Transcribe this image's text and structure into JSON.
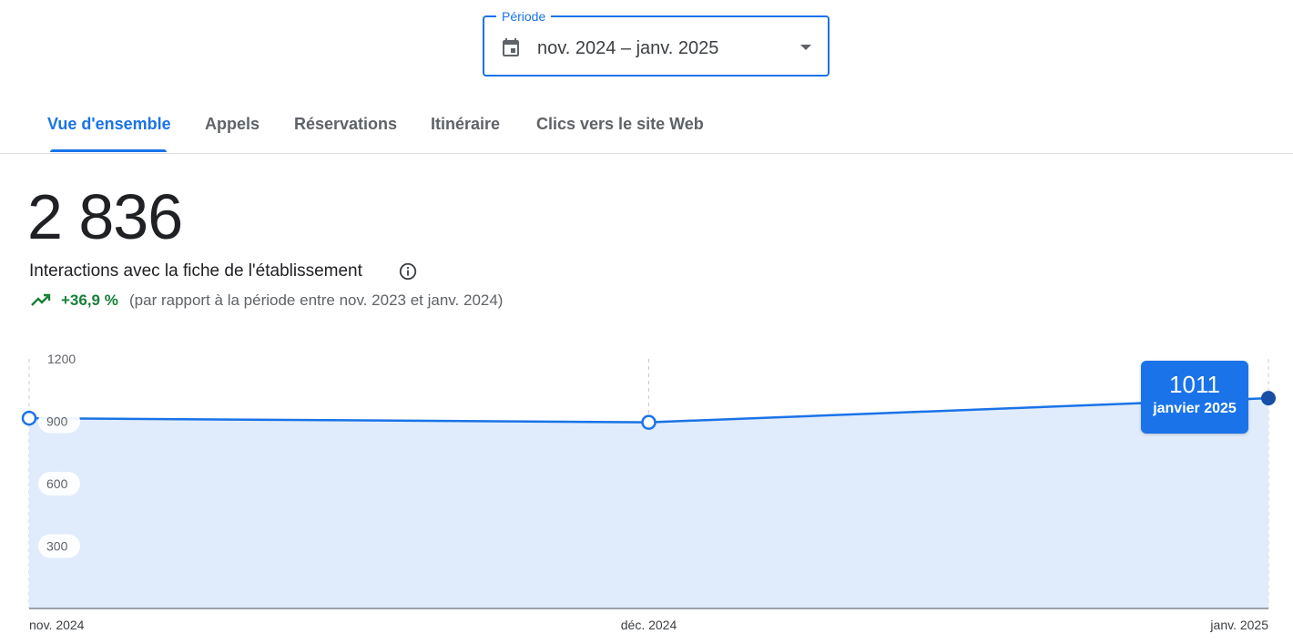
{
  "period": {
    "label": "Période",
    "value": "nov. 2024 – janv. 2025",
    "icon": "calendar-icon"
  },
  "tabs": [
    {
      "label": "Vue d'ensemble",
      "active": true
    },
    {
      "label": "Appels",
      "active": false
    },
    {
      "label": "Réservations",
      "active": false
    },
    {
      "label": "Itinéraire",
      "active": false
    },
    {
      "label": "Clics vers le site Web",
      "active": false
    }
  ],
  "metric": {
    "total": "2 836",
    "label": "Interactions avec la fiche de l'établissement",
    "change": "+36,9 %",
    "comparison": "(par rapport à la période entre nov. 2023 et janv. 2024)",
    "change_color": "#188038"
  },
  "tooltip": {
    "value": "1011",
    "label": "janvier 2025"
  },
  "colors": {
    "accent": "#1a73e8",
    "fill": "#e0ecfb",
    "positive": "#188038"
  },
  "chart_data": {
    "type": "area",
    "categories": [
      "nov. 2024",
      "déc. 2024",
      "janv. 2025"
    ],
    "values": [
      915,
      895,
      1011
    ],
    "ylim": [
      0,
      1200
    ],
    "yticks": [
      300,
      600,
      900,
      1200
    ],
    "grid": "vertical dashed",
    "highlighted_index": 2
  }
}
